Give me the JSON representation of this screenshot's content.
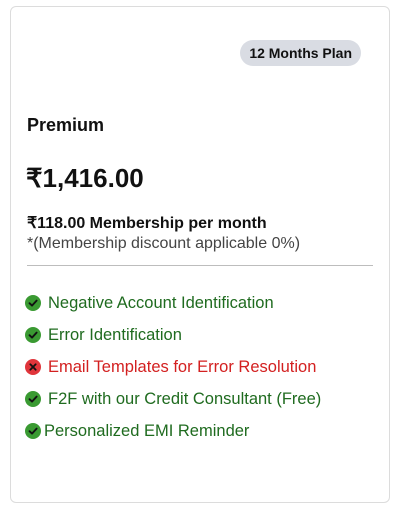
{
  "plan": {
    "badge": "12 Months Plan",
    "name": "Premium",
    "price": "₹1,416.00",
    "monthly": "₹118.00 Membership per month",
    "discount_note": "*(Membership discount applicable 0%)"
  },
  "colors": {
    "included": "#1f6b1f",
    "included_icon": "#3a9a32",
    "excluded": "#d32020",
    "excluded_icon": "#e0353b",
    "badge_bg": "#d9dce3"
  },
  "features": [
    {
      "label": "Negative Account Identification",
      "included": true,
      "icon": "check-circle-icon"
    },
    {
      "label": "Error Identification",
      "included": true,
      "icon": "check-circle-icon"
    },
    {
      "label": "Email Templates for Error Resolution",
      "included": false,
      "icon": "cross-circle-icon"
    },
    {
      "label": "F2F with our Credit Consultant (Free)",
      "included": true,
      "icon": "check-circle-icon"
    },
    {
      "label": "Personalized EMI Reminder",
      "included": true,
      "icon": "check-circle-icon"
    }
  ]
}
